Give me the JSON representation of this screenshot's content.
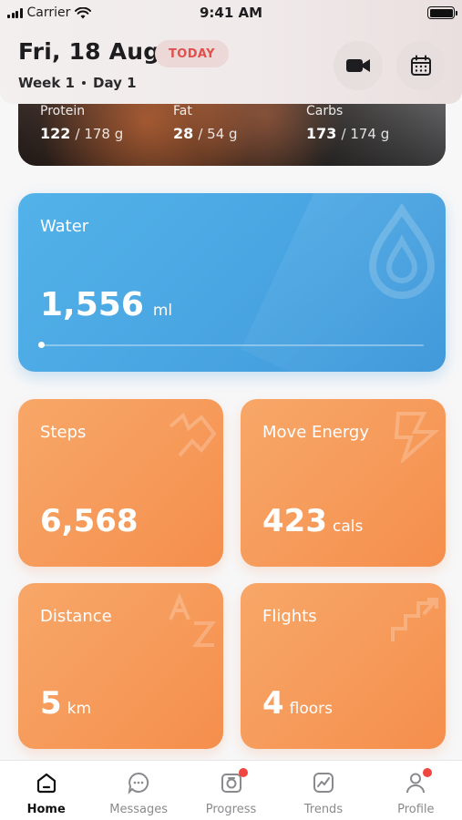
{
  "status_bar": {
    "carrier": "Carrier",
    "time": "9:41 AM"
  },
  "header": {
    "date": "Fri, 18 Aug",
    "badge": "TODAY",
    "week": "Week 1",
    "day": "Day 1"
  },
  "macros": [
    {
      "label": "Protein",
      "value": "122",
      "total": "/ 178 g"
    },
    {
      "label": "Fat",
      "value": "28",
      "total": "/ 54 g"
    },
    {
      "label": "Carbs",
      "value": "173",
      "total": "/ 174 g"
    }
  ],
  "water": {
    "title": "Water",
    "value": "1,556",
    "unit": "ml"
  },
  "tiles": {
    "steps": {
      "title": "Steps",
      "value": "6,568",
      "unit": ""
    },
    "energy": {
      "title": "Move Energy",
      "value": "423",
      "unit": "cals"
    },
    "distance": {
      "title": "Distance",
      "value": "5",
      "unit": "km"
    },
    "flights": {
      "title": "Flights",
      "value": "4",
      "unit": "floors"
    }
  },
  "tabs": [
    {
      "label": "Home",
      "active": true
    },
    {
      "label": "Messages",
      "active": false
    },
    {
      "label": "Progress",
      "active": false,
      "badge": true
    },
    {
      "label": "Trends",
      "active": false
    },
    {
      "label": "Profile",
      "active": false,
      "badge": true
    }
  ],
  "colors": {
    "accent_red": "#e0504d",
    "water_blue": "#4aa6e2",
    "tile_orange": "#f69a5a"
  }
}
